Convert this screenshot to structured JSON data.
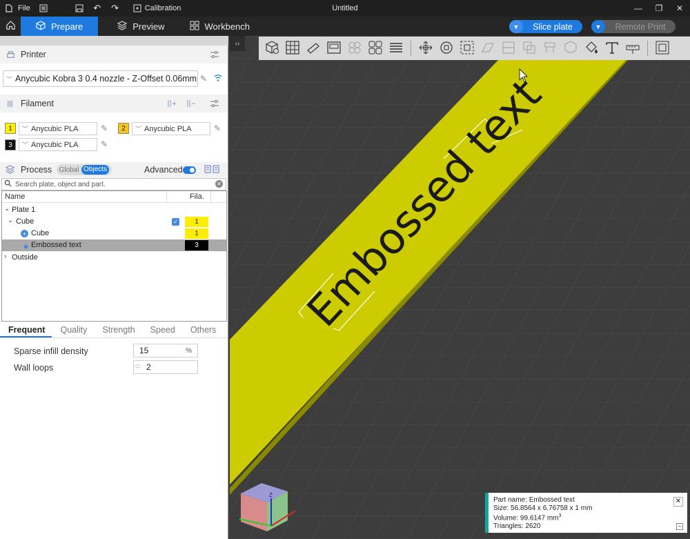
{
  "titlebar": {
    "file_label": "File",
    "calibration_label": "Calibration",
    "window_title": "Untitled"
  },
  "navbar": {
    "tabs": [
      {
        "label": "Prepare",
        "active": true
      },
      {
        "label": "Preview",
        "active": false
      },
      {
        "label": "Workbench",
        "active": false
      }
    ],
    "slice_label": "Slice plate",
    "remote_label": "Remote Print"
  },
  "printer": {
    "header": "Printer",
    "selected": "Anycubic Kobra 3 0.4 nozzle - Z-Offset 0.06mm..."
  },
  "filament": {
    "header": "Filament",
    "slots": [
      {
        "num": "1",
        "name": "Anycubic PLA",
        "color": "#ffee00"
      },
      {
        "num": "2",
        "name": "Anycubic PLA",
        "color": "#f5c518"
      },
      {
        "num": "3",
        "name": "Anycubic PLA",
        "color": "#111111"
      }
    ]
  },
  "process": {
    "header": "Process",
    "global_label": "Global",
    "objects_label": "Objects",
    "advanced_label": "Advanced",
    "advanced_on": true
  },
  "object_list": {
    "search_placeholder": "Search plate, object and part.",
    "col_name": "Name",
    "col_fila": "Fila.",
    "rows": [
      {
        "label": "Plate 1",
        "fila": ""
      },
      {
        "label": "Cube",
        "fila": "1"
      },
      {
        "label": "Cube",
        "fila": "1"
      },
      {
        "label": "Embossed text",
        "fila": "3"
      },
      {
        "label": "Outside",
        "fila": ""
      }
    ]
  },
  "settings_tabs": [
    "Frequent",
    "Quality",
    "Strength",
    "Speed",
    "Others"
  ],
  "params": {
    "infill_label": "Sparse infill density",
    "infill_value": "15",
    "infill_unit": "%",
    "walls_label": "Wall loops",
    "walls_value": "2"
  },
  "viewport": {
    "model_text": "Embossed text",
    "plate_color": "#cccc00"
  },
  "part_info": {
    "name": "Part name: Embossed text",
    "size": "Size: 56.8564 x 6.76758 x 1 mm",
    "volume_prefix": "Volume: 99.6147 mm",
    "volume_sup": "3",
    "triangles": "Triangles: 2620"
  }
}
